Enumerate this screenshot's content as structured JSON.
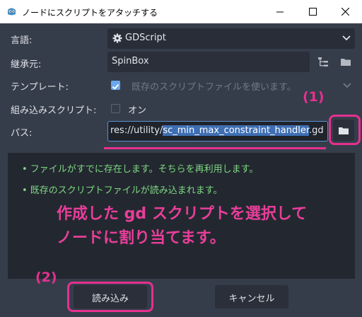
{
  "window": {
    "title": "ノードにスクリプトをアタッチする"
  },
  "form": {
    "language_label": "言語:",
    "language_value": "GDScript",
    "inherits_label": "継承元:",
    "inherits_value": "SpinBox",
    "template_label": "テンプレート:",
    "template_checked": true,
    "template_value": "既存のスクリプトファイルを使います。",
    "builtin_label": "組み込みスクリプト:",
    "builtin_checked": false,
    "builtin_value": "オン",
    "path_label": "パス:",
    "path_prefix": "res://utility/",
    "path_selected": "sc_min_max_constraint_handler",
    "path_suffix": ".gd"
  },
  "messages": [
    "• ファイルがすでに存在します。そちらを再利用します。",
    "• 既存のスクリプトファイルが読み込まれます。"
  ],
  "annotation": {
    "line1": "作成した gd スクリプトを選択して",
    "line2": "ノードに割り当てます。",
    "label1": "(1)",
    "label2": "(2)"
  },
  "buttons": {
    "load": "読み込み",
    "cancel": "キャンセル"
  },
  "colors": {
    "dialog_bg": "#363d4a",
    "message_green": "#7fd882",
    "annotation_pink": "#e6308f",
    "checkbox_blue": "#6aa7ec"
  },
  "icons": [
    "godot-logo-icon",
    "minimize-icon",
    "maximize-icon",
    "close-icon",
    "gear-icon",
    "chevron-down-icon",
    "class-tree-icon",
    "folder-icon",
    "check-icon"
  ]
}
